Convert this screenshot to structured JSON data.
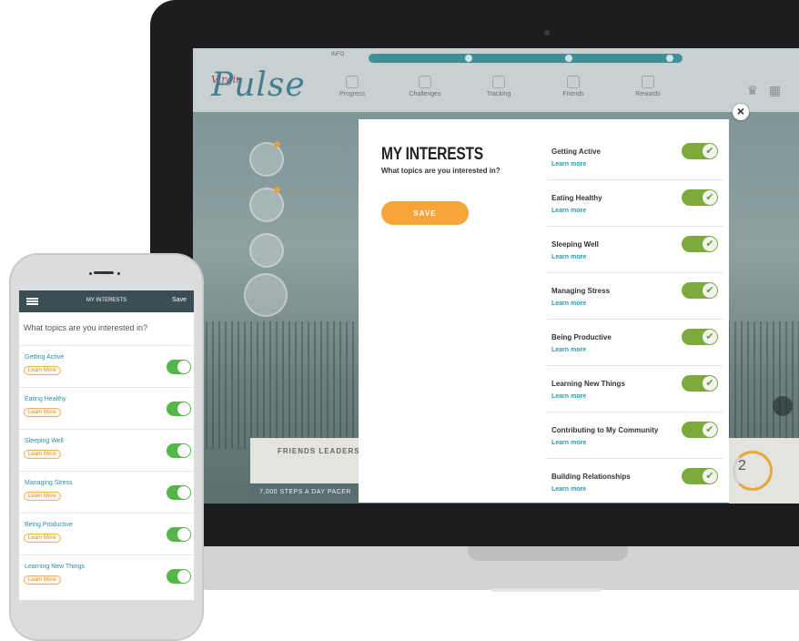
{
  "laptop_app": {
    "logo_prefix": "Virgin",
    "logo": "Pulse",
    "header_label": "INFO",
    "nav": [
      "Progress",
      "Challenges",
      "Tracking",
      "Friends",
      "Rewards"
    ],
    "friends_card_title": "FRIENDS LEADERS",
    "friends_card_bar": "7,000 STEPS A DAY PACER",
    "ring_number": "2"
  },
  "modal": {
    "title": "MY INTERESTS",
    "subtitle": "What topics are you interested in?",
    "save_label": "SAVE",
    "close_label": "×",
    "learn_more_label": "Learn more",
    "interests": [
      {
        "name": "Getting Active",
        "enabled": true
      },
      {
        "name": "Eating Healthy",
        "enabled": true
      },
      {
        "name": "Sleeping Well",
        "enabled": true
      },
      {
        "name": "Managing Stress",
        "enabled": true
      },
      {
        "name": "Being Productive",
        "enabled": true
      },
      {
        "name": "Learning New Things",
        "enabled": true
      },
      {
        "name": "Contributing to My Community",
        "enabled": true
      },
      {
        "name": "Building Relationships",
        "enabled": true
      }
    ]
  },
  "phone": {
    "header_title": "MY INTERESTS",
    "save_label": "Save",
    "question": "What topics are you interested in?",
    "learn_more_label": "Learn More",
    "interests": [
      {
        "name": "Getting Active",
        "enabled": true
      },
      {
        "name": "Eating Healthy",
        "enabled": true
      },
      {
        "name": "Sleeping Well",
        "enabled": true
      },
      {
        "name": "Managing Stress",
        "enabled": true
      },
      {
        "name": "Being Productive",
        "enabled": true
      },
      {
        "name": "Learning New Things",
        "enabled": true
      }
    ]
  },
  "colors": {
    "accent_orange": "#f6a53a",
    "toggle_green_desktop": "#7cab3c",
    "toggle_green_mobile": "#54b648",
    "link_blue": "#2c98b5",
    "phone_header": "#3a4e54"
  }
}
